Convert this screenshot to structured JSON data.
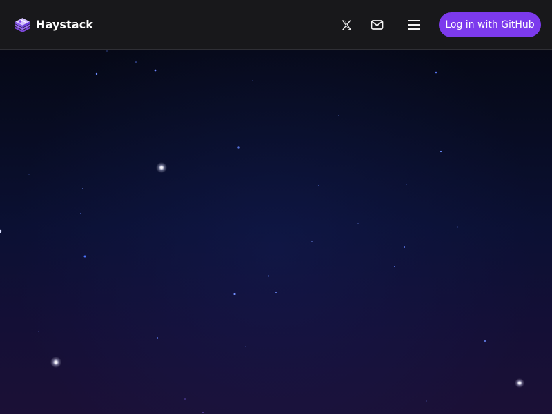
{
  "header": {
    "brand": {
      "name": "Haystack",
      "logo_icon": "layered-book-icon"
    },
    "actions": [
      {
        "name": "x-social-icon",
        "label": "X"
      },
      {
        "name": "mail-icon",
        "label": "Email"
      },
      {
        "name": "menu-icon",
        "label": "Menu"
      }
    ],
    "login_label": "Log in with GitHub"
  },
  "colors": {
    "header_background": "#18181b",
    "accent": "#7c3aed",
    "sky_top": "#05060f",
    "sky_bottom": "#1b1036",
    "star_bright": "#ffffff",
    "star_blue": "#6d8dff"
  }
}
